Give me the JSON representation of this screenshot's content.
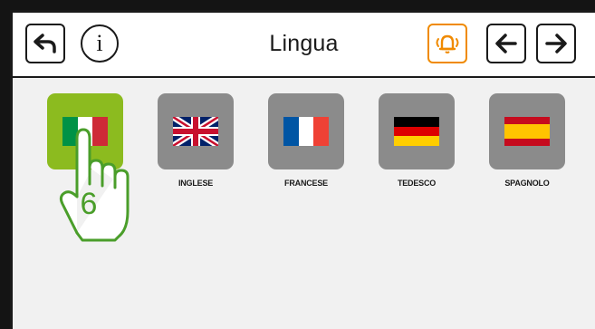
{
  "header": {
    "title": "Lingua",
    "buttons": {
      "back": "back-arrow-icon",
      "info": "i",
      "alarm": "bell-icon",
      "prev": "arrow-left-icon",
      "next": "arrow-right-icon"
    }
  },
  "languages": [
    {
      "label": "",
      "flag": "italy",
      "selected": true
    },
    {
      "label": "INGLESE",
      "flag": "uk",
      "selected": false
    },
    {
      "label": "FRANCESE",
      "flag": "france",
      "selected": false
    },
    {
      "label": "TEDESCO",
      "flag": "germany",
      "selected": false
    },
    {
      "label": "SPAGNOLO",
      "flag": "spain",
      "selected": false
    }
  ],
  "overlay": {
    "step_number": "6"
  },
  "colors": {
    "selected_tile": "#8cbb1f",
    "tile": "#8b8b8b",
    "alarm_accent": "#f08a00",
    "hand": "#4a9e2a"
  }
}
